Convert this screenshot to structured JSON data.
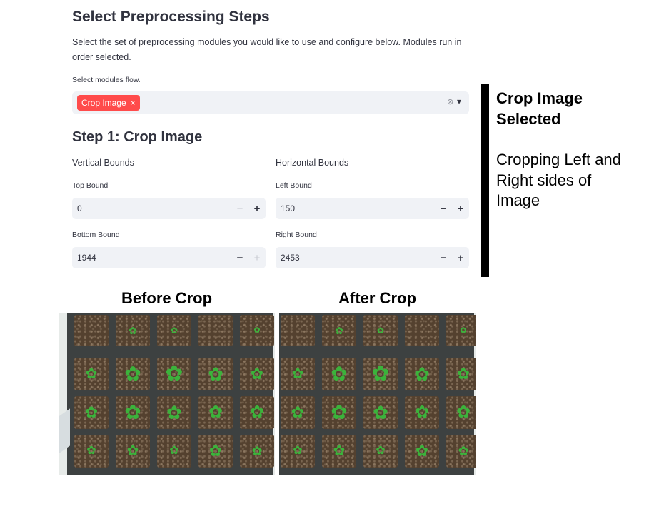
{
  "section": {
    "title": "Select Preprocessing Steps",
    "description": "Select the set of preprocessing modules you would like to use and configure below. Modules run in order selected.",
    "modules_label": "Select modules flow.",
    "selected_tag": "Crop Image",
    "tag_remove": "×",
    "clear_icon": "⊗",
    "dropdown_icon": "▾"
  },
  "step": {
    "title": "Step 1: Crop Image",
    "vertical_label": "Vertical Bounds",
    "horizontal_label": "Horizontal Bounds",
    "fields": {
      "top": {
        "label": "Top Bound",
        "value": "0"
      },
      "bottom": {
        "label": "Bottom Bound",
        "value": "1944"
      },
      "left": {
        "label": "Left Bound",
        "value": "150"
      },
      "right": {
        "label": "Right Bound",
        "value": "2453"
      }
    },
    "minus": "−",
    "plus": "+"
  },
  "annotation": {
    "title_line1": "Crop Image",
    "title_line2": "Selected",
    "body_line1": "Cropping Left and",
    "body_line2": "Right sides of",
    "body_line3": "Image"
  },
  "images": {
    "before_label": "Before Crop",
    "after_label": "After Crop"
  },
  "colors": {
    "accent": "#ff4b4b",
    "input_bg": "#f0f2f6",
    "text": "#31333f",
    "tray": "#3d4141",
    "plant": "#3bb33b"
  }
}
